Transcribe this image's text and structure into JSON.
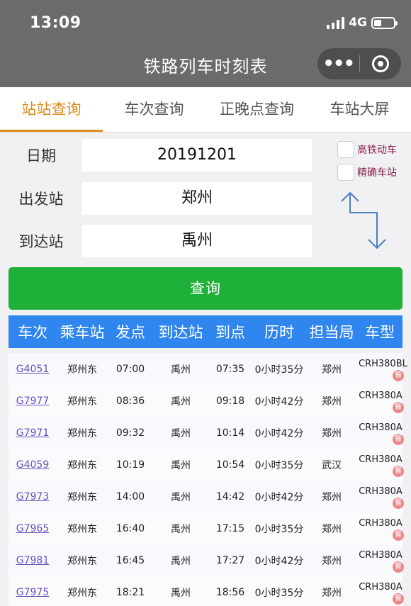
{
  "status": {
    "time": "13:09",
    "network": "4G"
  },
  "app": {
    "title": "铁路列车时刻表",
    "more_icon": "•••"
  },
  "tabs": [
    {
      "label": "站站查询",
      "active": true
    },
    {
      "label": "车次查询",
      "active": false
    },
    {
      "label": "正晚点查询",
      "active": false
    },
    {
      "label": "车站大屏",
      "active": false
    }
  ],
  "form": {
    "date_label": "日期",
    "date_value": "20191201",
    "from_label": "出发站",
    "from_value": "郑州",
    "to_label": "到达站",
    "to_value": "禹州",
    "opt_highspeed": "高铁动车",
    "opt_exact": "精确车站",
    "query_button": "查询"
  },
  "table": {
    "headers": [
      "车次",
      "乘车站",
      "发点",
      "到达站",
      "到点",
      "历时",
      "担当局",
      "车型"
    ],
    "meal_badge": "餐",
    "rows": [
      {
        "train": "G4051",
        "board": "郑州东",
        "depart": "07:00",
        "arrive_station": "禹州",
        "arrive": "07:35",
        "duration": "0小时35分",
        "bureau": "郑州",
        "type": "CRH380BL"
      },
      {
        "train": "G7977",
        "board": "郑州东",
        "depart": "08:36",
        "arrive_station": "禹州",
        "arrive": "09:18",
        "duration": "0小时42分",
        "bureau": "郑州",
        "type": "CRH380A"
      },
      {
        "train": "G7971",
        "board": "郑州东",
        "depart": "09:32",
        "arrive_station": "禹州",
        "arrive": "10:14",
        "duration": "0小时42分",
        "bureau": "郑州",
        "type": "CRH380A"
      },
      {
        "train": "G4059",
        "board": "郑州东",
        "depart": "10:19",
        "arrive_station": "禹州",
        "arrive": "10:54",
        "duration": "0小时35分",
        "bureau": "武汉",
        "type": "CRH380A"
      },
      {
        "train": "G7973",
        "board": "郑州东",
        "depart": "14:00",
        "arrive_station": "禹州",
        "arrive": "14:42",
        "duration": "0小时42分",
        "bureau": "郑州",
        "type": "CRH380A"
      },
      {
        "train": "G7965",
        "board": "郑州东",
        "depart": "16:40",
        "arrive_station": "禹州",
        "arrive": "17:15",
        "duration": "0小时35分",
        "bureau": "郑州",
        "type": "CRH380A"
      },
      {
        "train": "G7981",
        "board": "郑州东",
        "depart": "16:45",
        "arrive_station": "禹州",
        "arrive": "17:27",
        "duration": "0小时42分",
        "bureau": "郑州",
        "type": "CRH380A"
      },
      {
        "train": "G7975",
        "board": "郑州东",
        "depart": "18:21",
        "arrive_station": "禹州",
        "arrive": "18:56",
        "duration": "0小时35分",
        "bureau": "郑州",
        "type": "CRH380A"
      }
    ]
  },
  "colors": {
    "accent": "#e08a1e",
    "button": "#1fb03a",
    "table_header": "#2f86ef",
    "topbar": "#6b6b6b"
  }
}
